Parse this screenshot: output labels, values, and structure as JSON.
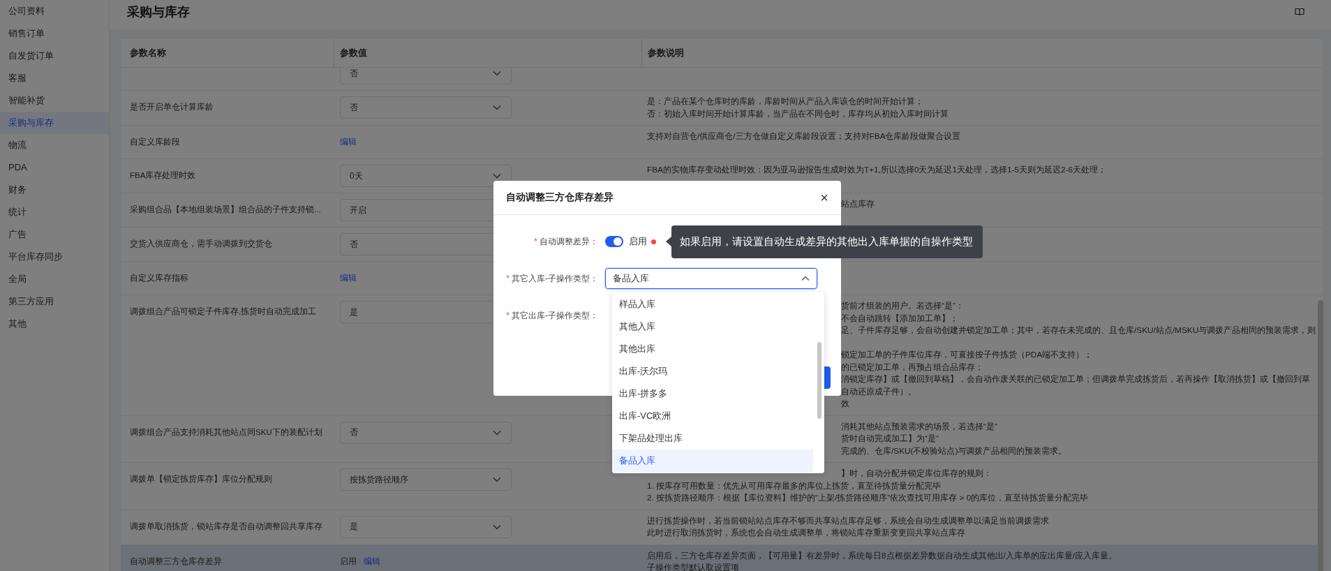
{
  "sidebar": {
    "items": [
      {
        "label": "公司资料",
        "selected": false
      },
      {
        "label": "销售订单",
        "selected": false
      },
      {
        "label": "自发货订单",
        "selected": false
      },
      {
        "label": "客服",
        "selected": false
      },
      {
        "label": "智能补货",
        "selected": false
      },
      {
        "label": "采购与库存",
        "selected": true
      },
      {
        "label": "物流",
        "selected": false
      },
      {
        "label": "PDA",
        "selected": false
      },
      {
        "label": "财务",
        "selected": false
      },
      {
        "label": "统计",
        "selected": false
      },
      {
        "label": "广告",
        "selected": false
      },
      {
        "label": "平台库存同步",
        "selected": false
      },
      {
        "label": "全局",
        "selected": false
      },
      {
        "label": "第三方应用",
        "selected": false
      },
      {
        "label": "其他",
        "selected": false
      }
    ]
  },
  "page": {
    "title": "采购与库存"
  },
  "table": {
    "columns": [
      "参数名称",
      "参数值",
      "参数说明"
    ],
    "rows": [
      {
        "value": {
          "kind": "select",
          "text": "否"
        },
        "highlighted": false
      },
      {
        "name": "是否开启单仓计算库龄",
        "value": {
          "kind": "select",
          "text": "否"
        },
        "highlighted": false,
        "description": [
          {
            "text": "是：产品在某个仓库时的库龄，库龄时间从产品入库该仓的时间开始计算；",
            "clipped": false
          },
          {
            "text": "否：初始入库时间开始计算库龄，当产品在不同仓时，库存均从初始入库时间计算",
            "clipped": false
          }
        ]
      },
      {
        "name": "自定义库龄段",
        "value": {
          "kind": "link",
          "link": "编辑"
        },
        "highlighted": false,
        "description": [
          {
            "text": "支持对自营仓/供应商仓/三方仓做自定义库龄段设置；支持对FBA仓库龄段做聚合设置",
            "clipped": false
          }
        ]
      },
      {
        "name": "FBA库存处理时效",
        "value": {
          "kind": "select",
          "text": "0天"
        },
        "highlighted": false,
        "description": [
          {
            "text": "FBA的实物库存变动处理时效：因为亚马逊报告生成时效为T+1,所以选择0天为延迟1天处理，选择1-5天则为延迟2-6天处理；",
            "clipped": false
          }
        ]
      },
      {
        "name": "采购组合品【本地组装场景】组合品的子件支持锁...",
        "value": {
          "kind": "select",
          "text": "开启"
        },
        "highlighted": false,
        "description": [
          {
            "text": "站点库存",
            "clipped": true
          }
        ]
      },
      {
        "name": "交货入供应商仓，需手动调拨到交货仓",
        "value": {
          "kind": "select",
          "text": "否"
        },
        "highlighted": false
      },
      {
        "name": "自定义库存指标",
        "value": {
          "kind": "link",
          "link": "编辑"
        },
        "highlighted": false
      },
      {
        "name": "调拨组合产品可锁定子件库存,拣货时自动完成加工",
        "value": {
          "kind": "select",
          "text": "是"
        },
        "highlighted": false,
        "description": [
          {
            "text": "货前才组装的用户。若选择“是”：",
            "clipped": true
          },
          {
            "text": "不会自动跳转【添加加工单】；",
            "clipped": true
          },
          {
            "text": "足、子件库存足够，会自动创建并锁定加工单；其中，若存在未完成的、且仓库/SKU/站点/MSKU与调拨产品相同的预装需求，则",
            "clipped": true
          },
          {
            "text": "锁定加工单的子件库位库存，可直接按子件拣货（PDA端不支持）；",
            "clipped": true,
            "after_gap": true
          },
          {
            "text": "的已锁定加工单，再预占组合品库存；",
            "clipped": true
          },
          {
            "text": "消锁定库存】或【撤回到草稿】，会自动作废关联的已锁定加工单；但调拨单完成拣货后，若再操作【取消拣货】或【撤回到草",
            "clipped": true
          },
          {
            "text": "自动还原成子件）。",
            "clipped": true
          },
          {
            "text": "效",
            "clipped": true
          }
        ]
      },
      {
        "name": "调拨组合产品支持消耗其他站点同SKU下的装配计划",
        "value": {
          "kind": "select",
          "text": "否"
        },
        "highlighted": false,
        "description": [
          {
            "text": "消耗其他站点预装需求的场景，若选择“是”",
            "clipped": true
          },
          {
            "text": "货时自动完成加工】为“是”",
            "clipped": true
          },
          {
            "text": "完成的、仓库/SKU(不校验站点)与调拨产品相同的预装需求。",
            "clipped": true
          }
        ]
      },
      {
        "name": "调拨单【锁定拣货库存】库位分配规则",
        "value": {
          "kind": "select",
          "text": "按拣货路径顺序"
        },
        "highlighted": false,
        "description": [
          {
            "text": "】时，自动分配并锁定库位库存的规则：",
            "clipped": true
          },
          {
            "text": "1. 按库存可用数量：优先从可用库存最多的库位上拣货，直至待拣货量分配完毕",
            "clipped": false
          },
          {
            "text": "2. 按拣货路径顺序：根据【库位资料】维护的“上架/拣货路径顺序”依次查找可用库存 > 0的库位，直至待拣货量分配完毕",
            "clipped": false
          }
        ]
      },
      {
        "name": "调拨单取消拣货，锁站库存是否自动调整回共享库存",
        "value": {
          "kind": "select",
          "text": "是"
        },
        "highlighted": false,
        "description": [
          {
            "text": "进行拣货操作时，若当前锁站站点库存不够而共享站点库存足够，系统会自动生成调整单以满足当前调拨需求",
            "clipped": false
          },
          {
            "text": "此时进行取消拣货时，系统也会自动生成调整单，将锁站库存重新变更回共享站点库存",
            "clipped": false
          }
        ]
      },
      {
        "name": "自动调整三方仓库存差异",
        "value": {
          "kind": "status_link",
          "text": "启用",
          "link": "编辑"
        },
        "highlighted": true,
        "description": [
          {
            "text": "启用后，三方仓库存差异页面，【可用量】有差异时，系统每日8点根据差异数据自动生成其他出/入库单的应出库量/应入库量。",
            "clipped": false
          },
          {
            "text": "子操作类型默认取设置项",
            "clipped": false
          }
        ]
      }
    ]
  },
  "modal": {
    "title": "自动调整三方仓库存差异",
    "close": "×",
    "fields": [
      {
        "kind": "switch",
        "required_mark": "*",
        "label": "自动调整差异：",
        "on": true,
        "text": "启用"
      },
      {
        "kind": "select",
        "required_mark": "*",
        "label": "其它入库-子操作类型：",
        "value": "备品入库",
        "expanded": true
      },
      {
        "kind": "select",
        "required_mark": "*",
        "label": "其它出库-子操作类型："
      }
    ],
    "options": [
      {
        "label": "样品入库",
        "selected": false
      },
      {
        "label": "其他入库",
        "selected": false
      },
      {
        "label": "其他出库",
        "selected": false
      },
      {
        "label": "出库-沃尔玛",
        "selected": false
      },
      {
        "label": "出库-拼多多",
        "selected": false
      },
      {
        "label": "出库-VC欧洲",
        "selected": false
      },
      {
        "label": "下架品处理出库",
        "selected": false
      },
      {
        "label": "备品入库",
        "selected": true
      }
    ]
  },
  "tooltip": {
    "text": "如果启用，请设置自动生成差异的其他出入库单据的自操作类型"
  }
}
